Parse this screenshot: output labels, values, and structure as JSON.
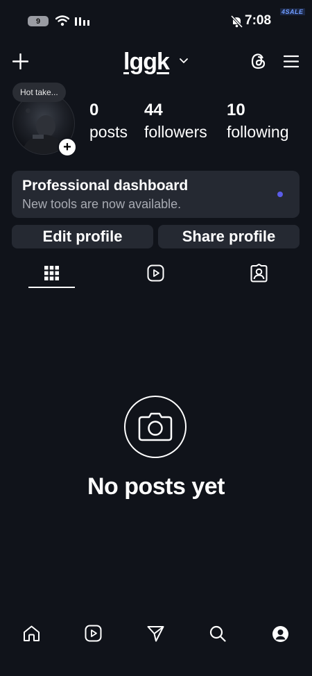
{
  "status_bar": {
    "battery": "9",
    "time": "7:08",
    "badge": "4SALE"
  },
  "header": {
    "username": "lggk"
  },
  "profile": {
    "note": "Hot take...",
    "stats": [
      {
        "value": "0",
        "label": "posts"
      },
      {
        "value": "44",
        "label": "followers"
      },
      {
        "value": "10",
        "label": "following"
      }
    ]
  },
  "dashboard": {
    "title": "Professional dashboard",
    "subtitle": "New tools are now available."
  },
  "buttons": {
    "edit": "Edit profile",
    "share": "Share profile"
  },
  "empty_state": {
    "title": "No posts yet"
  },
  "icons": {
    "tabs": [
      "grid-icon",
      "reels-icon",
      "tagged-icon"
    ],
    "nav": [
      "home-icon",
      "reels-icon",
      "send-icon",
      "search-icon",
      "profile-icon"
    ]
  }
}
